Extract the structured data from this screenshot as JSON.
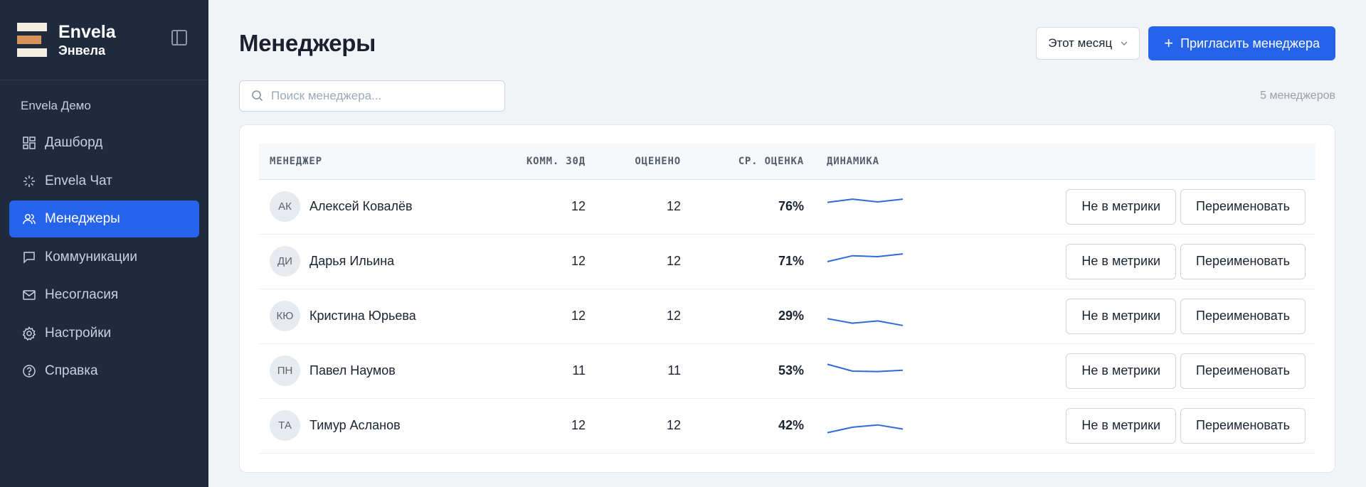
{
  "brand": {
    "name": "Envela",
    "subtitle": "Энвела"
  },
  "workspace": "Envela Демо",
  "nav": [
    {
      "label": "Дашборд",
      "icon": "dashboard-icon",
      "active": false
    },
    {
      "label": "Envela Чат",
      "icon": "sparkle-icon",
      "active": false
    },
    {
      "label": "Менеджеры",
      "icon": "users-icon",
      "active": true
    },
    {
      "label": "Коммуникации",
      "icon": "chat-bubble-icon",
      "active": false
    },
    {
      "label": "Несогласия",
      "icon": "mail-icon",
      "active": false
    },
    {
      "label": "Настройки",
      "icon": "gear-icon",
      "active": false
    },
    {
      "label": "Справка",
      "icon": "help-circle-icon",
      "active": false
    }
  ],
  "page": {
    "title": "Менеджеры",
    "period": "Этот месяц",
    "invite_label": "Пригласить менеджера",
    "search_placeholder": "Поиск менеджера...",
    "count": "5 менеджеров"
  },
  "table": {
    "columns": [
      "МЕНЕДЖЕР",
      "КОММ. 30Д",
      "ОЦЕНЕНО",
      "СР. ОЦЕНКА",
      "ДИНАМИКА"
    ],
    "rows": [
      {
        "initials": "АК",
        "name": "Алексей Ковалёв",
        "comm": "12",
        "rated": "12",
        "score": "76%",
        "trend": [
          0.55,
          0.62,
          0.56,
          0.62
        ]
      },
      {
        "initials": "ДИ",
        "name": "Дарья Ильина",
        "comm": "12",
        "rated": "12",
        "score": "71%",
        "trend": [
          0.45,
          0.58,
          0.56,
          0.62
        ]
      },
      {
        "initials": "КЮ",
        "name": "Кристина Юрьева",
        "comm": "12",
        "rated": "12",
        "score": "29%",
        "trend": [
          0.4,
          0.3,
          0.35,
          0.25
        ]
      },
      {
        "initials": "ПН",
        "name": "Павел Наумов",
        "comm": "11",
        "rated": "11",
        "score": "53%",
        "trend": [
          0.6,
          0.45,
          0.44,
          0.47
        ]
      },
      {
        "initials": "ТА",
        "name": "Тимур Асланов",
        "comm": "12",
        "rated": "12",
        "score": "42%",
        "trend": [
          0.3,
          0.42,
          0.47,
          0.38
        ]
      }
    ],
    "action_exclude": "Не в метрики",
    "action_rename": "Переименовать"
  },
  "colors": {
    "sidebar_bg": "#1f2a3d",
    "accent": "#2563eb",
    "spark": "#2f6bd8"
  }
}
